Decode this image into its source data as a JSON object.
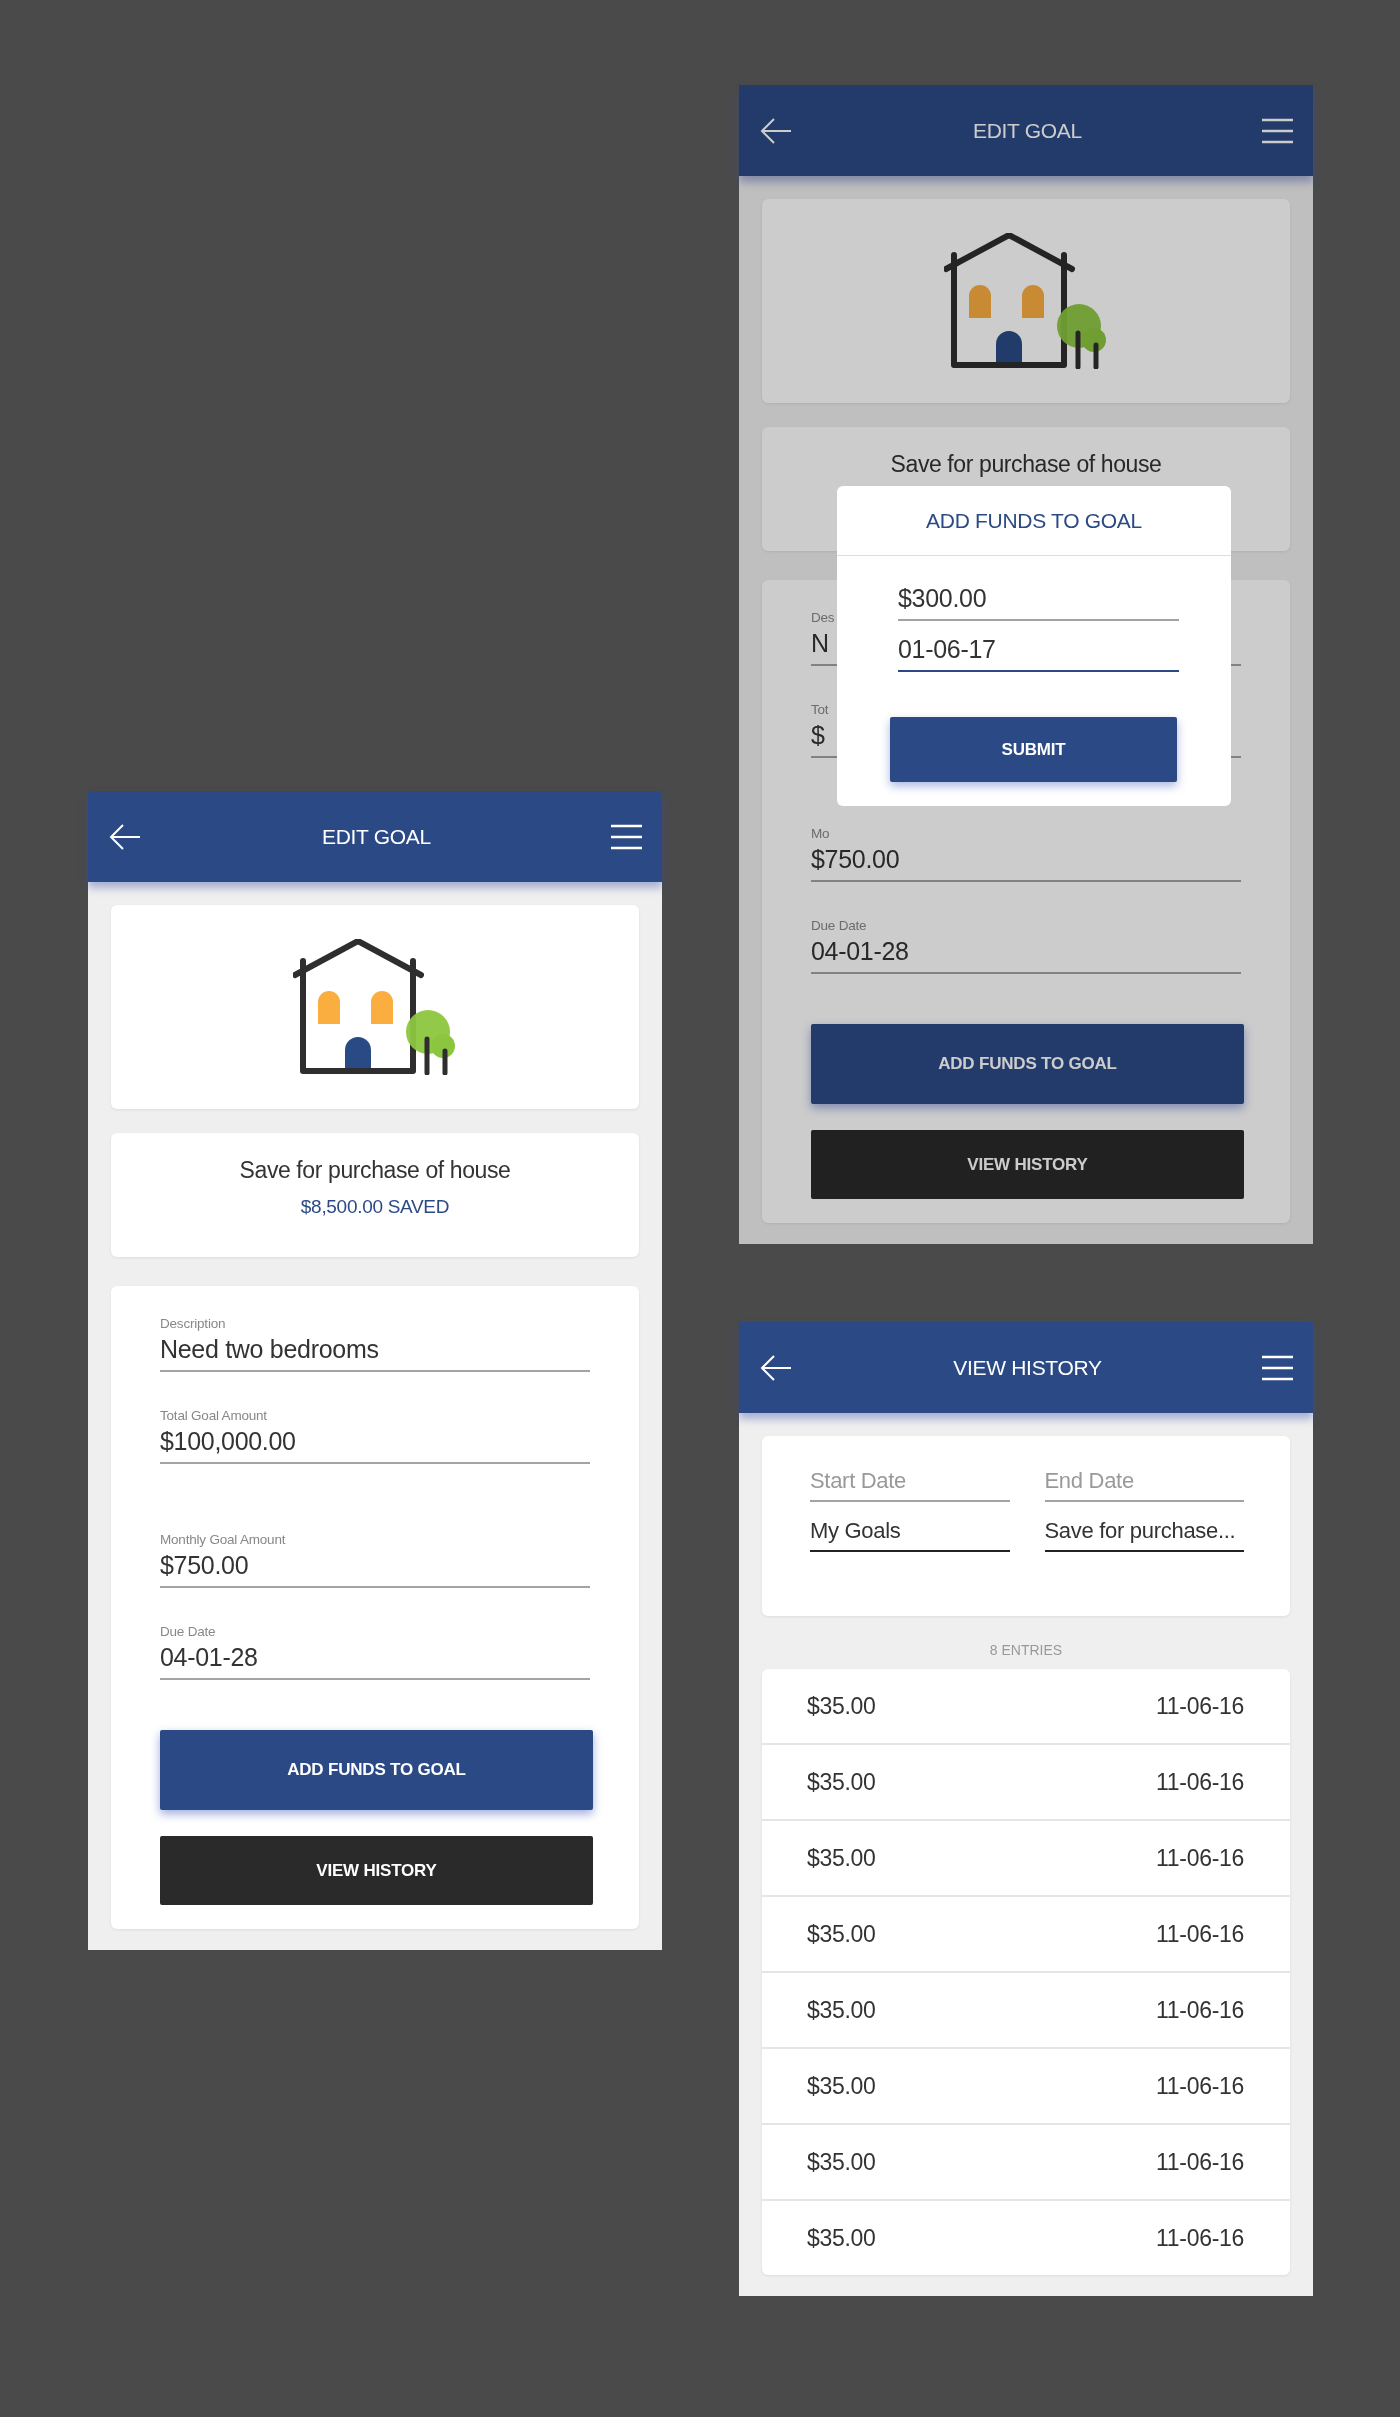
{
  "screens": [
    {
      "kind": "edit_goal",
      "dimmed": false,
      "header": {
        "title": "EDIT GOAL"
      },
      "goal": {
        "title": "Save for purchase of house",
        "saved": "$8,500.00 SAVED"
      },
      "fields": [
        {
          "label": "Description",
          "value": "Need two bedrooms"
        },
        {
          "label": "Total Goal Amount",
          "value": "$100,000.00"
        },
        {
          "label": "Monthly Goal Amount",
          "value": "$750.00"
        },
        {
          "label": "Due Date",
          "value": "04-01-28"
        }
      ],
      "buttons": [
        {
          "kind": "primary",
          "label": "ADD FUNDS TO GOAL"
        },
        {
          "kind": "dark",
          "label": "VIEW HISTORY"
        }
      ]
    },
    {
      "kind": "edit_goal",
      "dimmed": true,
      "header": {
        "title": "EDIT GOAL"
      },
      "goal": {
        "title": "Save for purchase of house"
      },
      "fields": [
        {
          "label": "Des",
          "value": "N"
        },
        {
          "label": "Tot",
          "value": "$"
        },
        {
          "label": "Mo",
          "value": "$750.00"
        },
        {
          "label": "Due Date",
          "value": "04-01-28"
        }
      ],
      "buttons": [
        {
          "kind": "primary",
          "label": "ADD FUNDS TO GOAL"
        },
        {
          "kind": "dark",
          "label": "VIEW HISTORY"
        }
      ],
      "dialog": {
        "title": "ADD FUNDS TO GOAL",
        "fields": [
          {
            "value": "$300.00",
            "focused": false
          },
          {
            "value": "01-06-17",
            "focused": true
          }
        ],
        "button": "SUBMIT"
      }
    },
    {
      "kind": "view_history",
      "dimmed": false,
      "header": {
        "title": "VIEW HISTORY"
      },
      "filters": [
        {
          "placeholder": "Start Date"
        },
        {
          "placeholder": "End Date"
        },
        {
          "value": "My Goals"
        },
        {
          "value": "Save for purchase..."
        }
      ],
      "count": "8 ENTRIES",
      "entries": [
        {
          "amount": "$35.00",
          "date": "11-06-16"
        },
        {
          "amount": "$35.00",
          "date": "11-06-16"
        },
        {
          "amount": "$35.00",
          "date": "11-06-16"
        },
        {
          "amount": "$35.00",
          "date": "11-06-16"
        },
        {
          "amount": "$35.00",
          "date": "11-06-16"
        },
        {
          "amount": "$35.00",
          "date": "11-06-16"
        },
        {
          "amount": "$35.00",
          "date": "11-06-16"
        },
        {
          "amount": "$35.00",
          "date": "11-06-16"
        }
      ]
    }
  ]
}
